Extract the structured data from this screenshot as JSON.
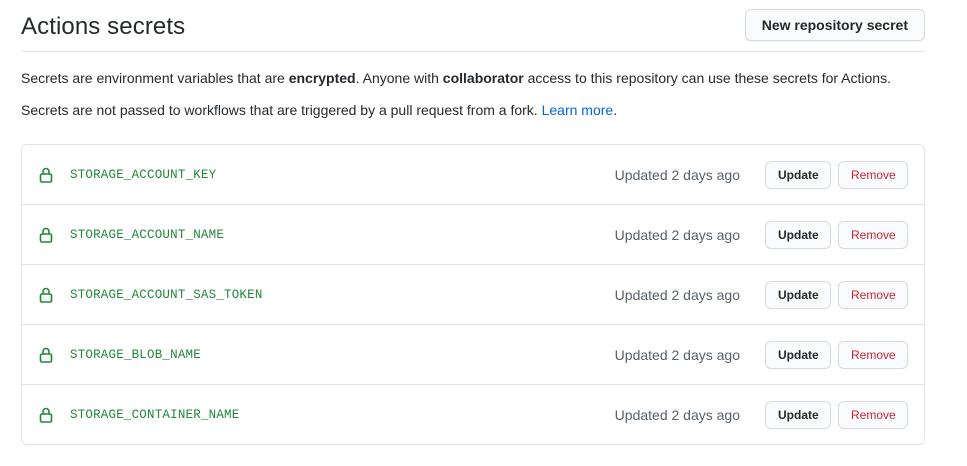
{
  "header": {
    "title": "Actions secrets",
    "new_secret_label": "New repository secret"
  },
  "description": {
    "line1_part1": "Secrets are environment variables that are ",
    "line1_bold1": "encrypted",
    "line1_part2": ". Anyone with ",
    "line1_bold2": "collaborator",
    "line1_part3": " access to this repository can use these secrets for Actions.",
    "line2_text": "Secrets are not passed to workflows that are triggered by a pull request from a fork. ",
    "line2_link": "Learn more",
    "line2_end": "."
  },
  "secrets": [
    {
      "name": "STORAGE_ACCOUNT_KEY",
      "updated": "Updated 2 days ago",
      "update_label": "Update",
      "remove_label": "Remove"
    },
    {
      "name": "STORAGE_ACCOUNT_NAME",
      "updated": "Updated 2 days ago",
      "update_label": "Update",
      "remove_label": "Remove"
    },
    {
      "name": "STORAGE_ACCOUNT_SAS_TOKEN",
      "updated": "Updated 2 days ago",
      "update_label": "Update",
      "remove_label": "Remove"
    },
    {
      "name": "STORAGE_BLOB_NAME",
      "updated": "Updated 2 days ago",
      "update_label": "Update",
      "remove_label": "Remove"
    },
    {
      "name": "STORAGE_CONTAINER_NAME",
      "updated": "Updated 2 days ago",
      "update_label": "Update",
      "remove_label": "Remove"
    }
  ],
  "icons": {
    "secret_icon": "lock-icon"
  },
  "colors": {
    "secret_name": "#22863a",
    "link": "#0366d6",
    "remove": "#cb2431",
    "muted": "#586069"
  }
}
